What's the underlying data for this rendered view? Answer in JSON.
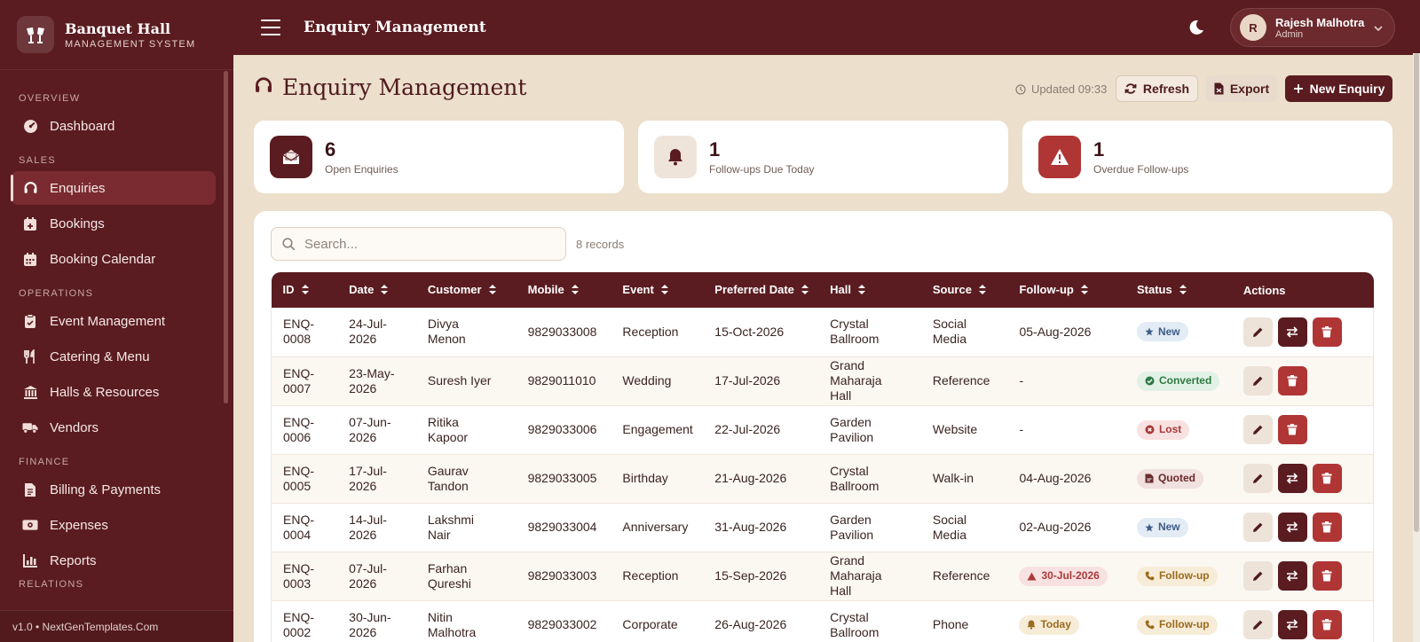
{
  "brand": {
    "title": "Banquet Hall",
    "subtitle": "MANAGEMENT SYSTEM"
  },
  "sidebar": {
    "sections": [
      {
        "label": "OVERVIEW",
        "items": [
          {
            "label": "Dashboard",
            "icon": "gauge-icon"
          }
        ]
      },
      {
        "label": "SALES",
        "items": [
          {
            "label": "Enquiries",
            "icon": "headset-icon",
            "active": true
          },
          {
            "label": "Bookings",
            "icon": "calendar-plus-icon"
          },
          {
            "label": "Booking Calendar",
            "icon": "calendar-icon"
          }
        ]
      },
      {
        "label": "OPERATIONS",
        "items": [
          {
            "label": "Event Management",
            "icon": "clipboard-icon"
          },
          {
            "label": "Catering & Menu",
            "icon": "utensils-icon"
          },
          {
            "label": "Halls & Resources",
            "icon": "building-icon"
          },
          {
            "label": "Vendors",
            "icon": "truck-icon"
          }
        ]
      },
      {
        "label": "FINANCE",
        "items": [
          {
            "label": "Billing & Payments",
            "icon": "invoice-icon"
          },
          {
            "label": "Expenses",
            "icon": "money-icon"
          },
          {
            "label": "Reports",
            "icon": "bar-chart-icon"
          }
        ]
      }
    ],
    "partial_section": "RELATIONS",
    "footer": "v1.0 • NextGenTemplates.Com"
  },
  "topbar": {
    "title": "Enquiry Management",
    "user_name": "Rajesh Malhotra",
    "user_role": "Admin",
    "user_initial": "R"
  },
  "header": {
    "title": "Enquiry Management",
    "updated": "Updated 09:33",
    "refresh_label": "Refresh",
    "export_label": "Export",
    "new_label": "New Enquiry"
  },
  "stats": [
    {
      "value": "6",
      "label": "Open Enquiries",
      "icon": "envelope-open-icon"
    },
    {
      "value": "1",
      "label": "Follow-ups Due Today",
      "icon": "bell-icon"
    },
    {
      "value": "1",
      "label": "Overdue Follow-ups",
      "icon": "warning-icon"
    }
  ],
  "search": {
    "placeholder": "Search...",
    "value": ""
  },
  "records_label": "8 records",
  "table": {
    "columns": [
      "ID",
      "Date",
      "Customer",
      "Mobile",
      "Event",
      "Preferred Date",
      "Hall",
      "Source",
      "Follow-up",
      "Status",
      "Actions"
    ],
    "rows": [
      {
        "id": "ENQ-0008",
        "date": "24-Jul-2026",
        "customer": "Divya Menon",
        "mobile": "9829033008",
        "event": "Reception",
        "preferred": "15-Oct-2026",
        "hall": "Crystal Ballroom",
        "source": "Social Media",
        "followup": "05-Aug-2026",
        "followup_badge": "",
        "status": "New",
        "status_type": "new",
        "convert": true
      },
      {
        "id": "ENQ-0007",
        "date": "23-May-2026",
        "customer": "Suresh Iyer",
        "mobile": "9829011010",
        "event": "Wedding",
        "preferred": "17-Jul-2026",
        "hall": "Grand Maharaja Hall",
        "source": "Reference",
        "followup": "-",
        "followup_badge": "",
        "status": "Converted",
        "status_type": "converted",
        "convert": false
      },
      {
        "id": "ENQ-0006",
        "date": "07-Jun-2026",
        "customer": "Ritika Kapoor",
        "mobile": "9829033006",
        "event": "Engagement",
        "preferred": "22-Jul-2026",
        "hall": "Garden Pavilion",
        "source": "Website",
        "followup": "-",
        "followup_badge": "",
        "status": "Lost",
        "status_type": "lost",
        "convert": false
      },
      {
        "id": "ENQ-0005",
        "date": "17-Jul-2026",
        "customer": "Gaurav Tandon",
        "mobile": "9829033005",
        "event": "Birthday",
        "preferred": "21-Aug-2026",
        "hall": "Crystal Ballroom",
        "source": "Walk-in",
        "followup": "04-Aug-2026",
        "followup_badge": "",
        "status": "Quoted",
        "status_type": "quoted",
        "convert": true
      },
      {
        "id": "ENQ-0004",
        "date": "14-Jul-2026",
        "customer": "Lakshmi Nair",
        "mobile": "9829033004",
        "event": "Anniversary",
        "preferred": "31-Aug-2026",
        "hall": "Garden Pavilion",
        "source": "Social Media",
        "followup": "02-Aug-2026",
        "followup_badge": "",
        "status": "New",
        "status_type": "new",
        "convert": true
      },
      {
        "id": "ENQ-0003",
        "date": "07-Jul-2026",
        "customer": "Farhan Qureshi",
        "mobile": "9829033003",
        "event": "Reception",
        "preferred": "15-Sep-2026",
        "hall": "Grand Maharaja Hall",
        "source": "Reference",
        "followup": "30-Jul-2026",
        "followup_badge": "overdue",
        "status": "Follow-up",
        "status_type": "followup",
        "convert": true
      },
      {
        "id": "ENQ-0002",
        "date": "30-Jun-2026",
        "customer": "Nitin Malhotra",
        "mobile": "9829033002",
        "event": "Corporate",
        "preferred": "26-Aug-2026",
        "hall": "Crystal Ballroom",
        "source": "Phone",
        "followup": "Today",
        "followup_badge": "today",
        "status": "Follow-up",
        "status_type": "followup",
        "convert": true
      }
    ]
  },
  "colors": {
    "primary": "#5a1c20",
    "background": "#ecdfcc",
    "danger": "#b03535"
  }
}
